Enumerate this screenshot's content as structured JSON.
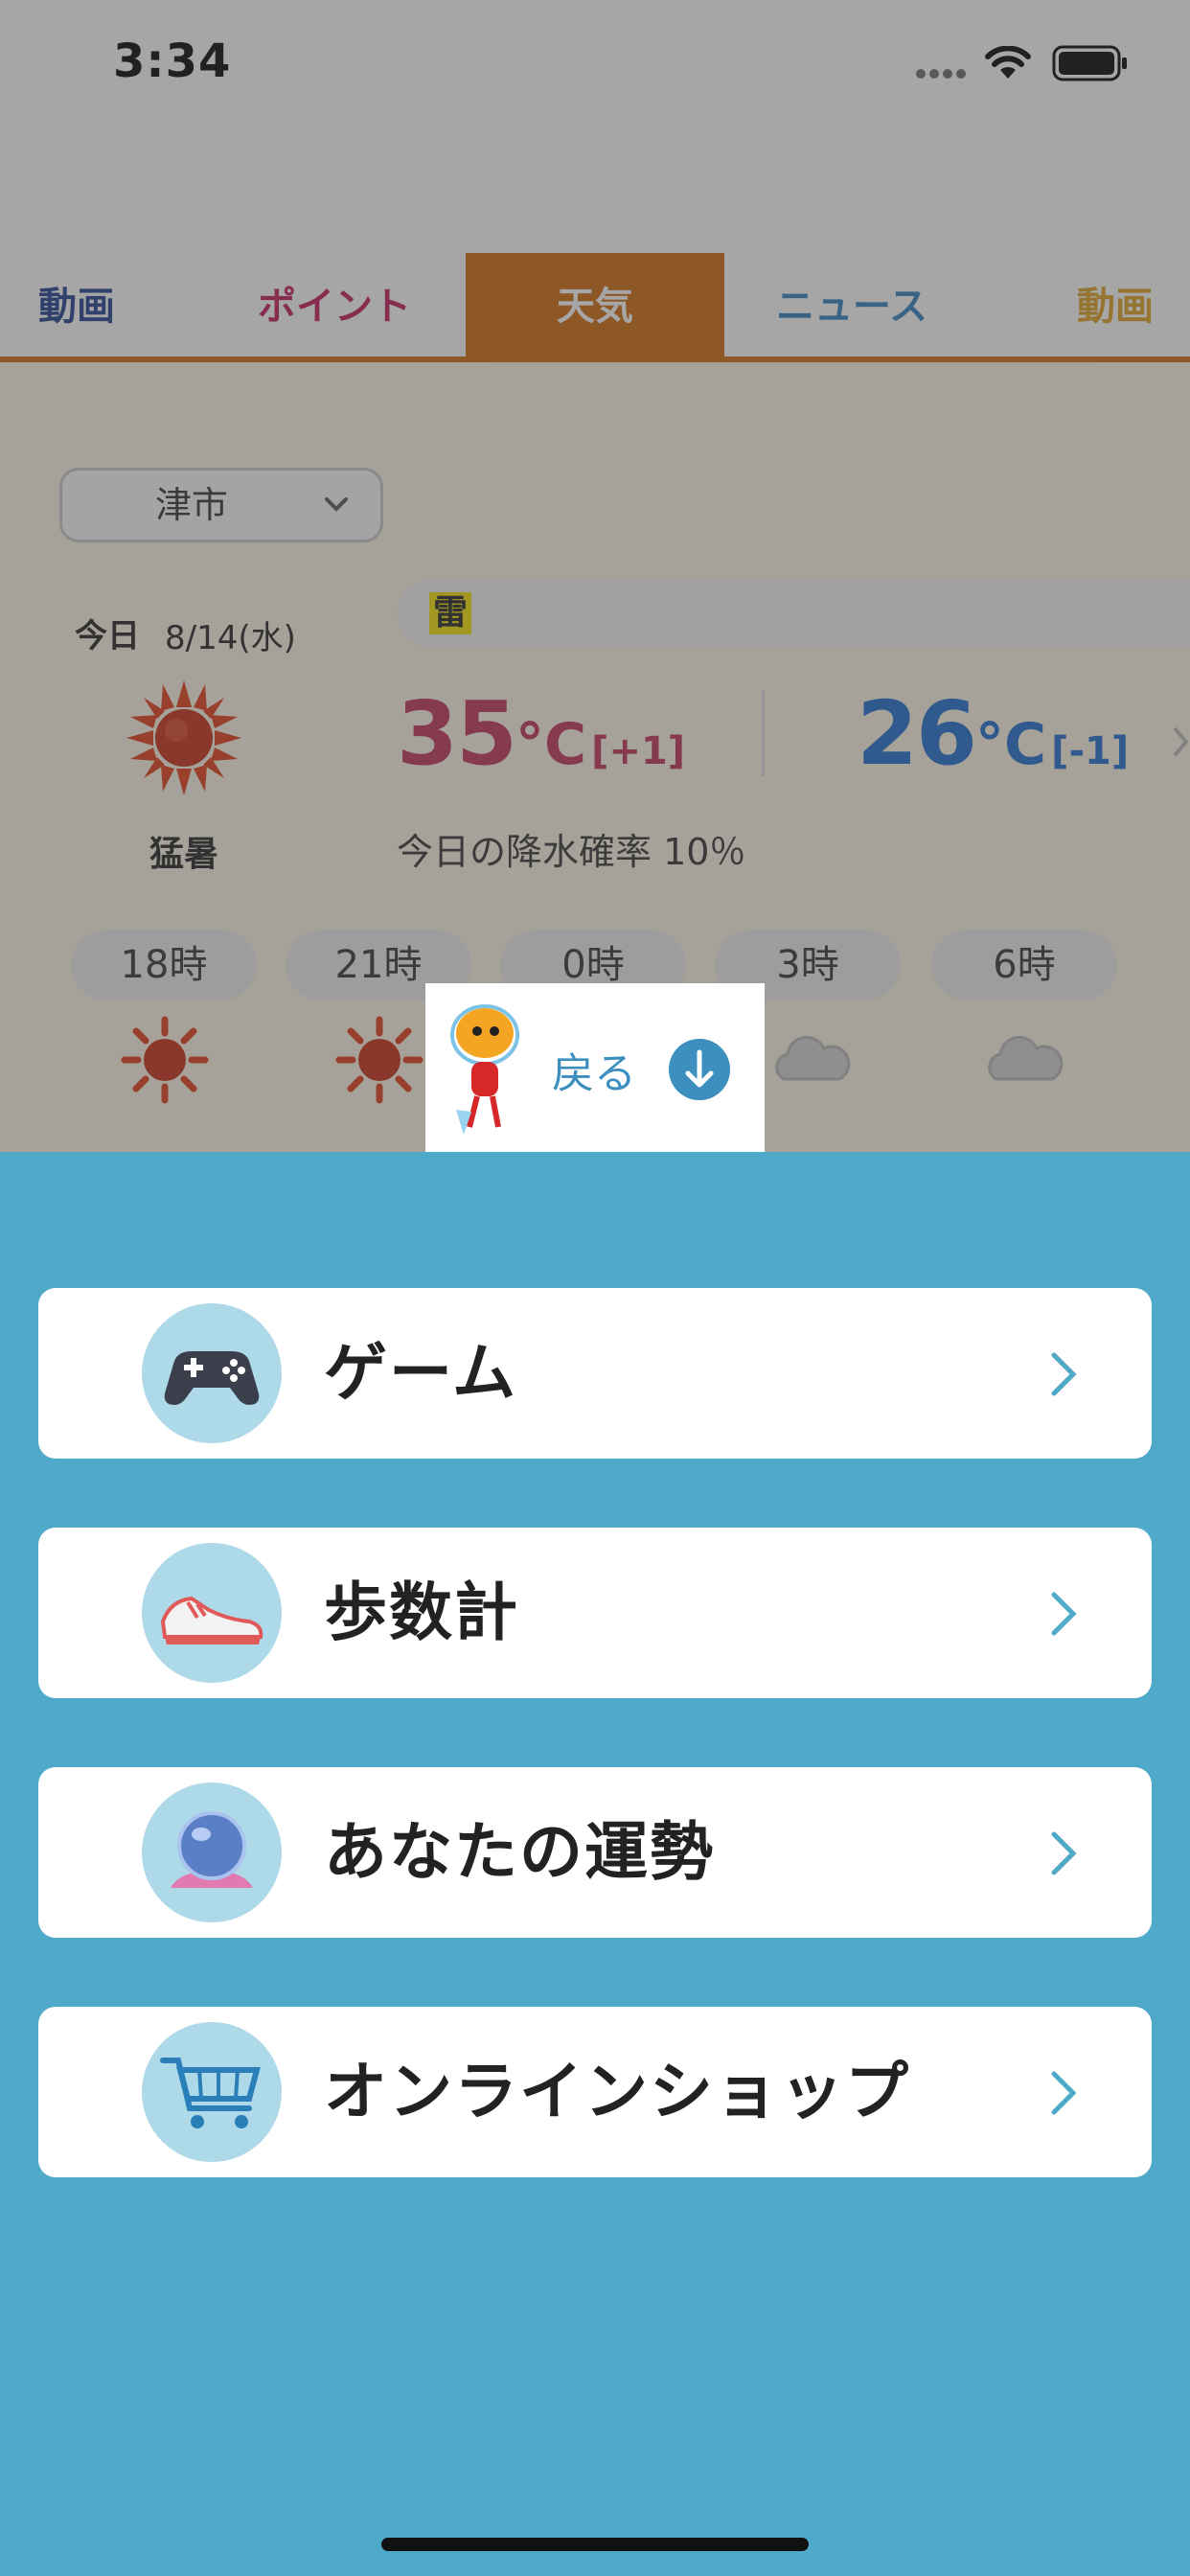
{
  "status_bar": {
    "time": "3:34"
  },
  "tabs": [
    {
      "label": "動画",
      "color": "#1e3e8e"
    },
    {
      "label": "ポイント",
      "color": "#c2185b"
    },
    {
      "label": "天気",
      "color": "#ffffff",
      "active": true,
      "active_bg": "#d0690a"
    },
    {
      "label": "ニュース",
      "color": "#2e7fc0"
    },
    {
      "label": "動画",
      "color": "#e0a020"
    }
  ],
  "weather": {
    "city": "津市",
    "alert": "雷",
    "today_label": "今日",
    "today_date": "8/14(水)",
    "condition": "猛暑",
    "condition_icon": "sun-icon",
    "high": {
      "value": "35",
      "unit": "°C",
      "diff": "[+1]",
      "color": "#c0305a"
    },
    "low": {
      "value": "26",
      "unit": "°C",
      "diff": "[-1]",
      "color": "#1e6ed0"
    },
    "rain_text": "今日の降水確率 10％",
    "hourly": [
      {
        "time": "18時",
        "icon": "sun-icon"
      },
      {
        "time": "21時",
        "icon": "sun-icon"
      },
      {
        "time": "0時",
        "icon": "sun-icon"
      },
      {
        "time": "3時",
        "icon": "cloud-icon"
      },
      {
        "time": "6時",
        "icon": "cloud-icon"
      }
    ]
  },
  "back_button": {
    "label": "戻る",
    "icon": "down-arrow-icon"
  },
  "menu": {
    "background": "#4fa9c8",
    "items": [
      {
        "label": "ゲーム",
        "icon": "gamepad-icon"
      },
      {
        "label": "歩数計",
        "icon": "sneaker-icon"
      },
      {
        "label": "あなたの運勢",
        "icon": "crystal-ball-icon"
      },
      {
        "label": "オンラインショップ",
        "icon": "shopping-cart-icon"
      }
    ]
  }
}
